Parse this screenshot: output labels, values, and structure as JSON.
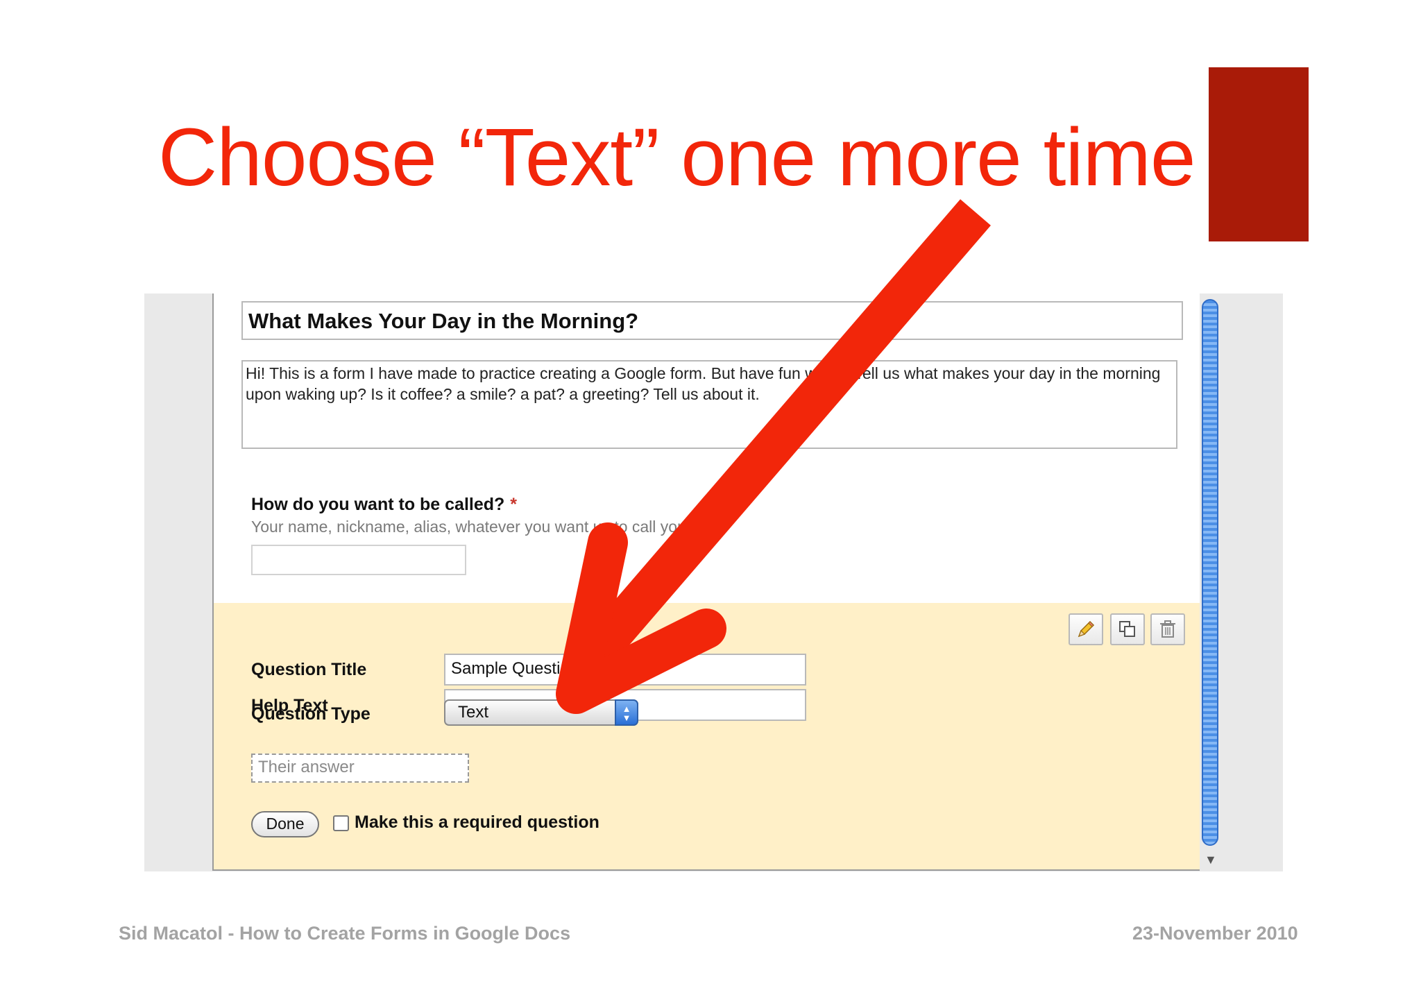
{
  "slide": {
    "title": "Choose “Text” one more time",
    "title_color": "#f2260a",
    "accent_color": "#a91b08",
    "arrow_color": "#f2260a"
  },
  "form": {
    "title": "What Makes Your Day in the Morning?",
    "description": "Hi! This is a form I have made to practice creating a Google form. But have fun with it! Tell us what makes your day in the morning upon waking up? Is it coffee? a smile? a pat? a greeting? Tell us about it.",
    "question": {
      "title": "How do you want to be called?",
      "required_marker": "*",
      "help_text": "Your name, nickname, alias, whatever you want us to call you."
    },
    "editor": {
      "question_title_label": "Question Title",
      "question_title_value": "Sample Question",
      "help_text_label": "Help Text",
      "help_text_value": "",
      "question_type_label": "Question Type",
      "question_type_value": "Text",
      "answer_placeholder": "Their answer",
      "done_label": "Done",
      "required_label": "Make this a required question",
      "required_checked": false,
      "tools": [
        "pencil-icon",
        "duplicate-icon",
        "trash-icon"
      ],
      "background_color": "#fff0c8"
    }
  },
  "footer": {
    "left": "Sid Macatol - How to Create Forms in Google Docs",
    "right": "23-November 2010"
  }
}
